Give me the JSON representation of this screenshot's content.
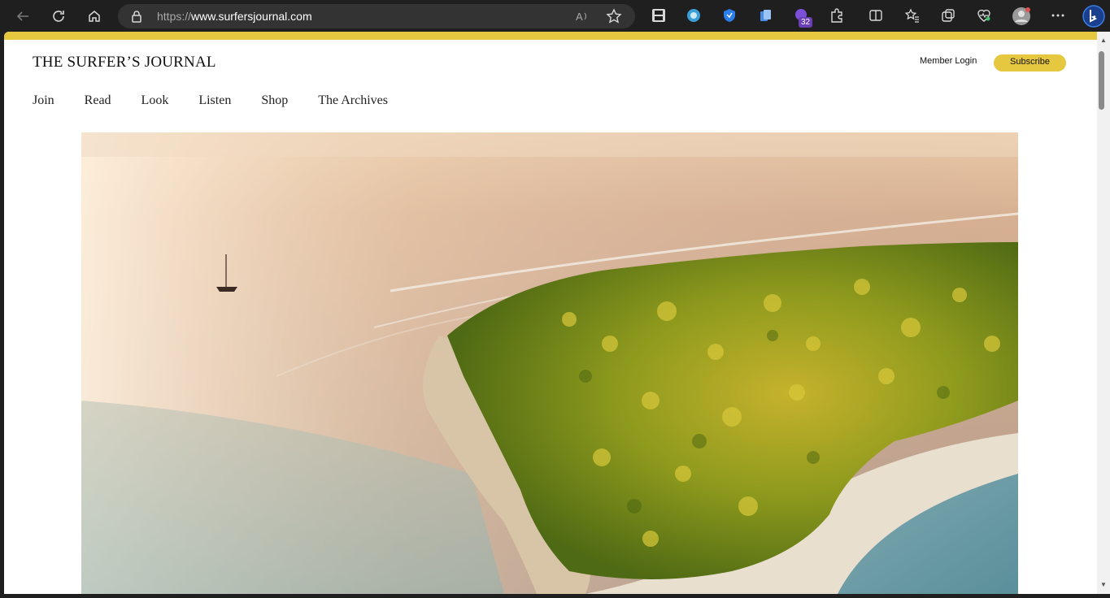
{
  "browser": {
    "url_prefix": "https://",
    "url_domain": "www.surfersjournal.com",
    "extension_badge": "32"
  },
  "site": {
    "logo": "THE SURFER’S JOURNAL",
    "member_login": "Member Login",
    "subscribe": "Subscribe",
    "nav": [
      "Join",
      "Read",
      "Look",
      "Listen",
      "Shop",
      "The Archives"
    ]
  },
  "colors": {
    "accent": "#e6c740",
    "chrome": "#1f1f1f"
  }
}
